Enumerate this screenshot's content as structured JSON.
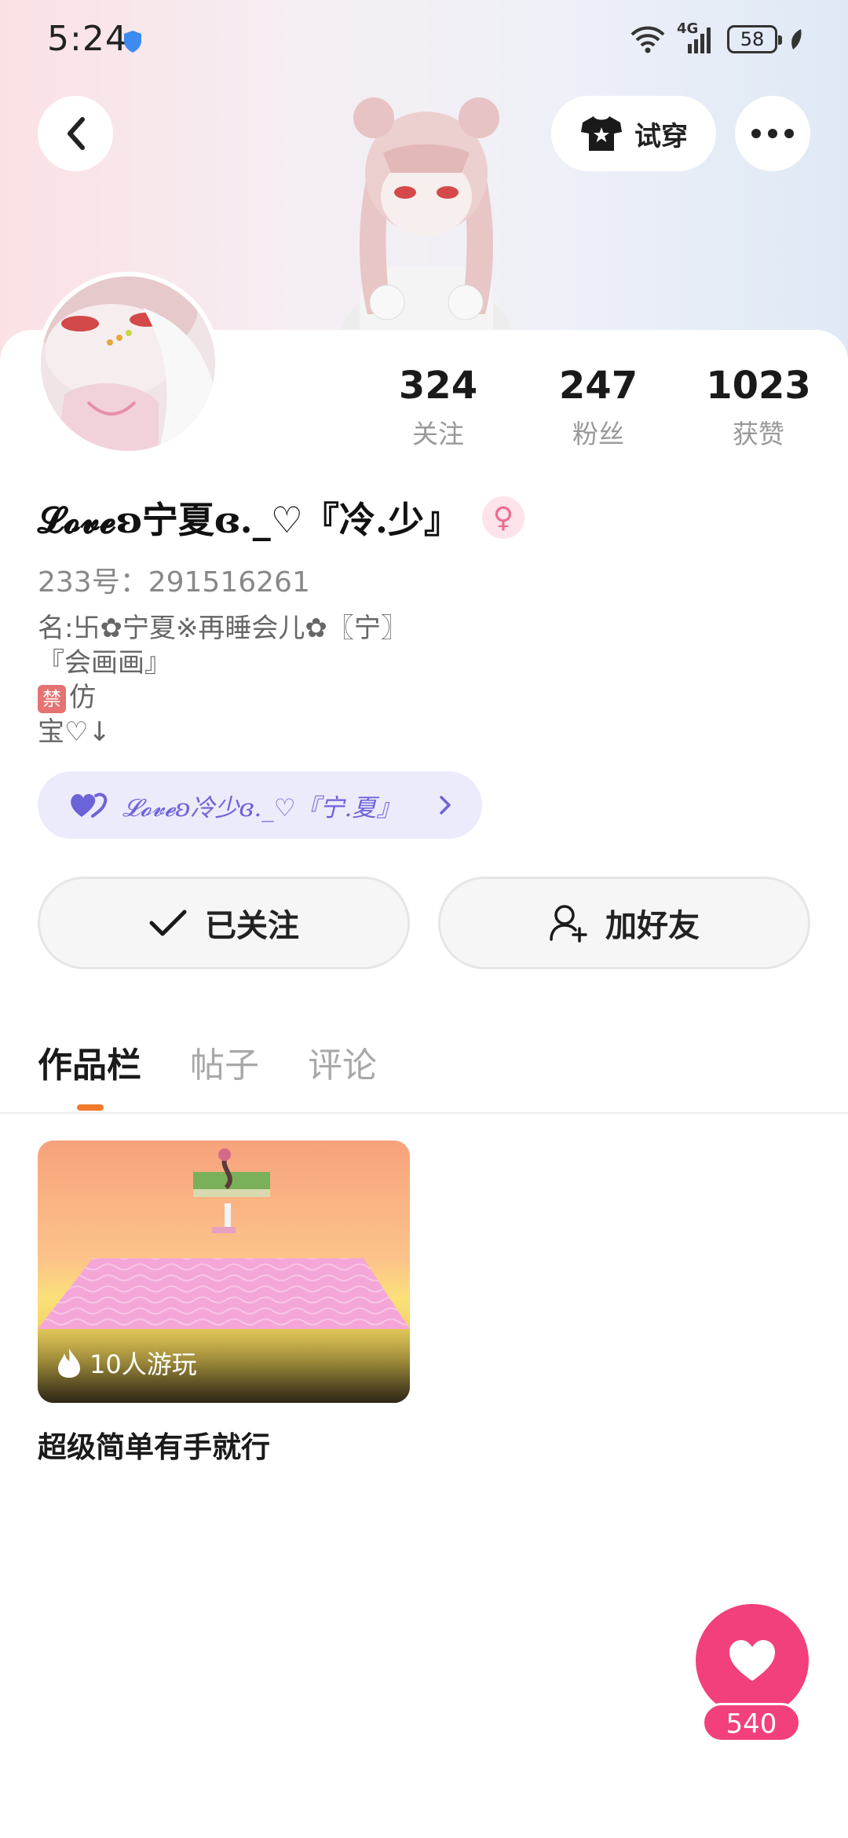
{
  "status_bar": {
    "time": "5:24",
    "network": "4G",
    "battery": "58"
  },
  "header": {
    "try_on_label": "试穿"
  },
  "profile": {
    "stats": [
      {
        "value": "324",
        "label": "关注"
      },
      {
        "value": "247",
        "label": "粉丝"
      },
      {
        "value": "1023",
        "label": "获赞"
      }
    ],
    "nickname": "𝓛𝓸𝓿𝓮ʚ宁夏ɞ._♡『冷.少』",
    "gender_symbol": "♀",
    "uid": "233号：291516261",
    "bio": [
      "名:卐✿宁夏※再睡会儿✿〖宁〗",
      "『会画画』",
      "仿",
      "宝♡↓"
    ],
    "ban_badge": "禁",
    "cp_link": "𝓛𝓸𝓿𝓮ʚ冷少ɞ._♡『宁.夏』"
  },
  "actions": {
    "follow_label": "已关注",
    "add_friend_label": "加好友"
  },
  "tabs": [
    {
      "label": "作品栏",
      "active": true
    },
    {
      "label": "帖子",
      "active": false
    },
    {
      "label": "评论",
      "active": false
    }
  ],
  "works": [
    {
      "plays": "10人游玩",
      "title": "超级简单有手就行"
    }
  ],
  "fab": {
    "count": "540"
  },
  "colors": {
    "accent": "#f2407d",
    "tab_indicator": "#f07a2c",
    "cp_text": "#6d63d8"
  }
}
